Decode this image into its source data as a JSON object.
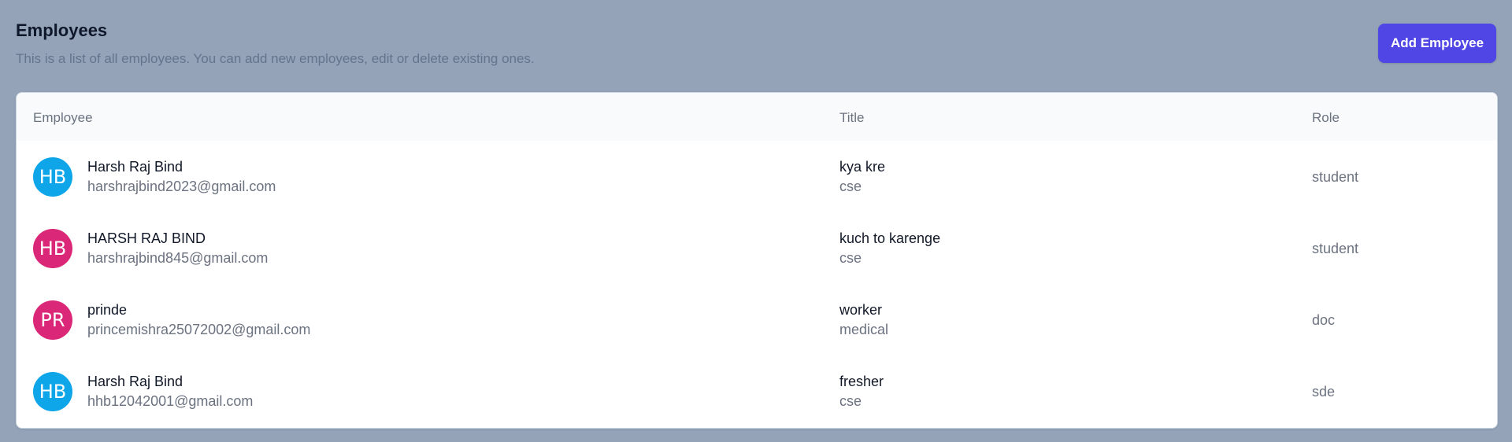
{
  "header": {
    "title": "Employees",
    "subtitle": "This is a list of all employees. You can add new employees, edit or delete existing ones.",
    "add_button_label": "Add Employee"
  },
  "table": {
    "columns": [
      "Employee",
      "Title",
      "Role"
    ],
    "rows": [
      {
        "avatar_initials": "HB",
        "avatar_color": "#0ea5e9",
        "name": "Harsh Raj Bind",
        "email": "harshrajbind2023@gmail.com",
        "title": "kya kre",
        "department": "cse",
        "role": "student"
      },
      {
        "avatar_initials": "HB",
        "avatar_color": "#db2777",
        "name": "HARSH RAJ BIND",
        "email": "harshrajbind845@gmail.com",
        "title": "kuch to karenge",
        "department": "cse",
        "role": "student"
      },
      {
        "avatar_initials": "PR",
        "avatar_color": "#db2777",
        "name": "prinde",
        "email": "princemishra25072002@gmail.com",
        "title": "worker",
        "department": "medical",
        "role": "doc"
      },
      {
        "avatar_initials": "HB",
        "avatar_color": "#0ea5e9",
        "name": "Harsh Raj Bind",
        "email": "hhb12042001@gmail.com",
        "title": "fresher",
        "department": "cse",
        "role": "sde"
      }
    ]
  },
  "colors": {
    "page_background": "#94a3b8",
    "accent": "#4f46e5"
  }
}
